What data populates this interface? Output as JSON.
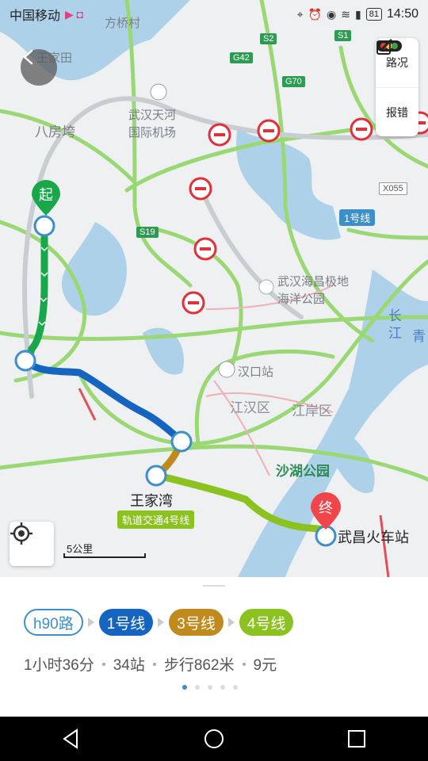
{
  "status_bar": {
    "carrier": "中国移动",
    "battery": "81",
    "time": "14:50"
  },
  "map": {
    "places": {
      "wangjiatian": "王家田",
      "fangqiao": "方桥村",
      "bafangwan": "八房垮",
      "airport_line1": "武汉天河",
      "airport_line2": "国际机场",
      "haichang_line1": "武汉海昌极地",
      "haichang_line2": "海洋公园",
      "hankou_station": "汉口站",
      "jianghan": "江汉区",
      "jiangan": "江岸区",
      "shahu": "沙湖公园",
      "wangjiawan": "王家湾",
      "wuchang_station": "武昌火车站",
      "changjiang1": "长",
      "changjiang2": "江",
      "qing": "青"
    },
    "road_tags": {
      "s2": "S2",
      "s1": "S1",
      "g42": "G42",
      "g70": "G70",
      "s19": "S19",
      "x055": "X055"
    },
    "metro_tag": "1号线",
    "line4_tag": "轨道交通4号线",
    "start_label": "起",
    "end_label": "终",
    "scale_label": "5公里"
  },
  "side_panel": {
    "traffic_label": "路况",
    "report_label": "报错"
  },
  "route": {
    "segments": [
      "h90路",
      "1号线",
      "3号线",
      "4号线"
    ],
    "duration": "1小时36分",
    "stops": "34站",
    "walk": "步行862米",
    "fare": "9元"
  },
  "pager": {
    "count": 5,
    "active": 0
  },
  "colors": {
    "bus": "#3d8fc9",
    "line1": "#1565c0",
    "line3": "#c08a1c",
    "line4": "#8cc21f",
    "walk_green": "#18a84a",
    "end_marker": "#f0454a"
  }
}
